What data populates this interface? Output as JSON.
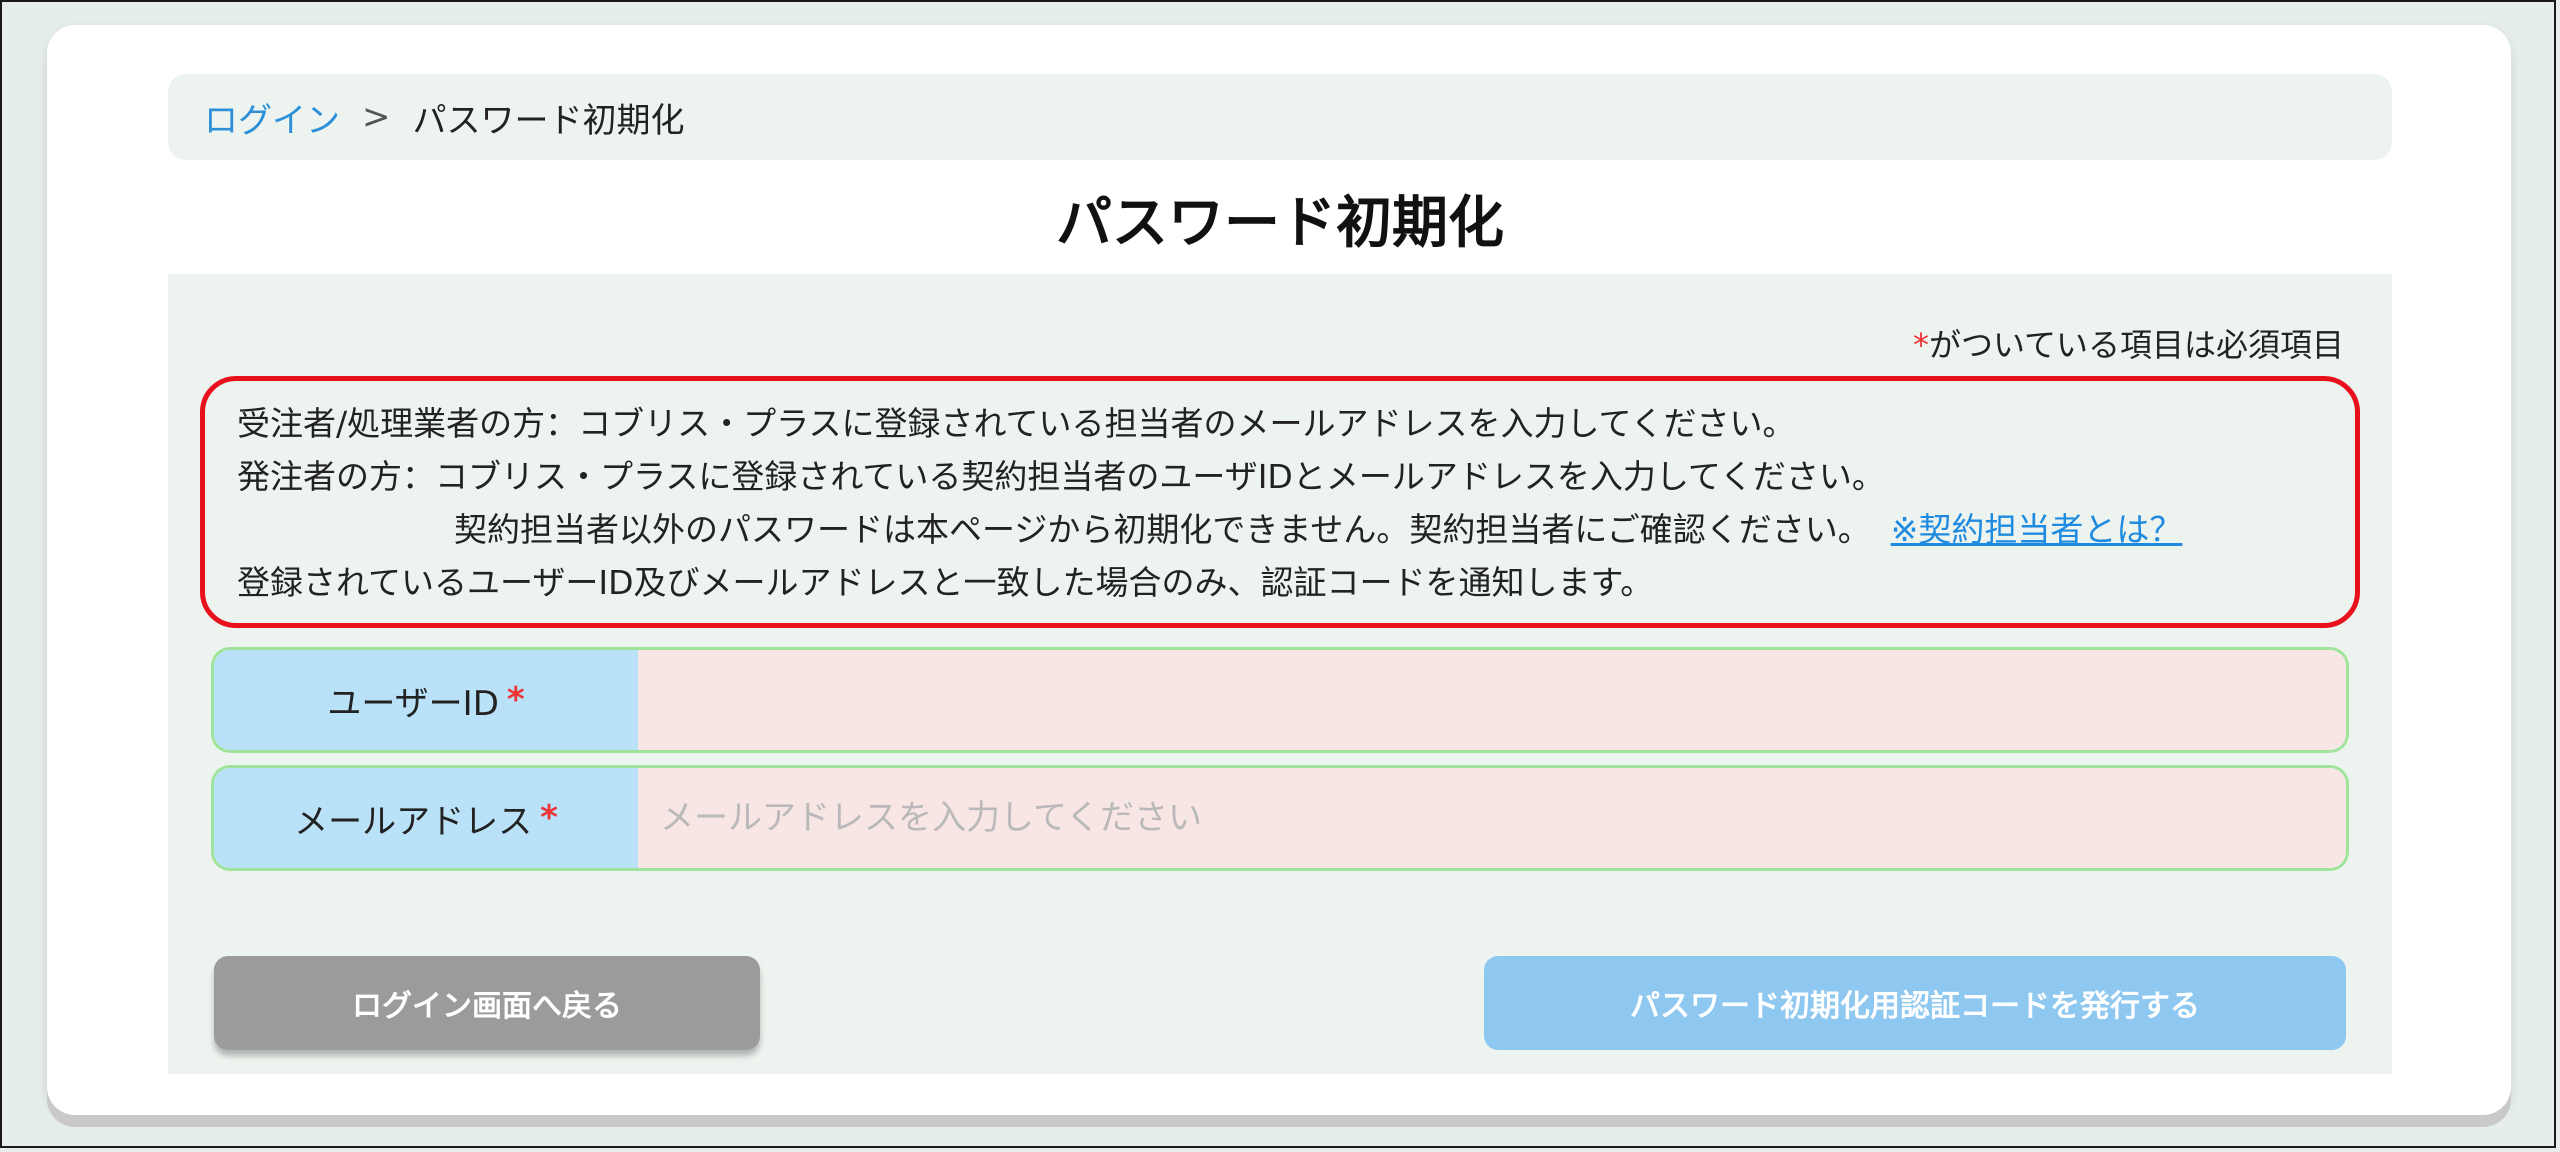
{
  "breadcrumb": {
    "login_link": "ログイン",
    "separator": ">",
    "current": "パスワード初期化"
  },
  "page_title": "パスワード初期化",
  "required_note": {
    "star": "*",
    "text": "がついている項目は必須項目"
  },
  "info": {
    "line1": "受注者/処理業者の方：コブリス・プラスに登録されている担当者のメールアドレスを入力してください。",
    "line2": "発注者の方：コブリス・プラスに登録されている契約担当者のユーザIDとメールアドレスを入力してください。",
    "line3": "契約担当者以外のパスワードは本ページから初期化できません。契約担当者にご確認ください。",
    "line3_link": "※契約担当者とは？",
    "line4": "登録されているユーザーID及びメールアドレスと一致した場合のみ、認証コードを通知します。"
  },
  "fields": {
    "user_id": {
      "label": "ユーザーID",
      "star": "*",
      "value": "",
      "placeholder": ""
    },
    "email": {
      "label": "メールアドレス",
      "star": "*",
      "value": "",
      "placeholder": "メールアドレスを入力してください"
    }
  },
  "buttons": {
    "back_label": "ログイン画面へ戻る",
    "issue_label": "パスワード初期化用認証コードを発行する"
  },
  "colors": {
    "accent_link": "#2d8fd8",
    "required": "#e33333",
    "info_border": "#e8101c",
    "label_bg": "#b9e1f8",
    "input_bg": "#f8e6e5",
    "back_button": "#9b9b9b",
    "issue_button": "#8ec8f0"
  }
}
